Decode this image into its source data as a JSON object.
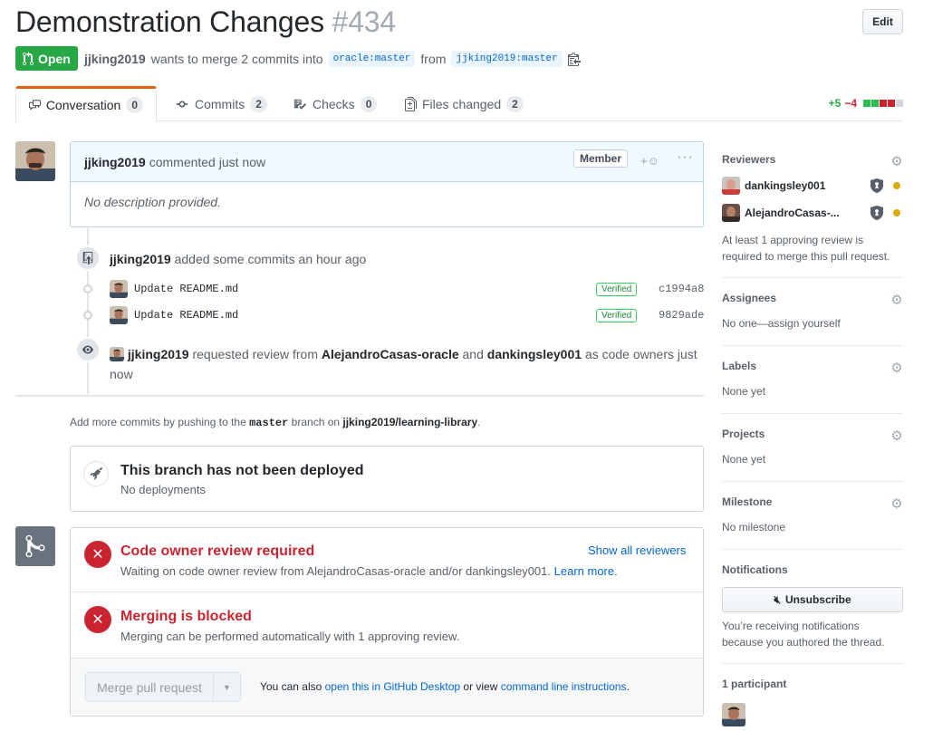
{
  "pr": {
    "title": "Demonstration Changes",
    "number": "#434",
    "edit_label": "Edit",
    "state": "Open",
    "author": "jjking2019",
    "merge_text": "wants to merge 2 commits into",
    "base_branch": "oracle:master",
    "from_text": "from",
    "head_branch": "jjking2019:master"
  },
  "tabs": [
    {
      "label": "Conversation",
      "count": "0"
    },
    {
      "label": "Commits",
      "count": "2"
    },
    {
      "label": "Checks",
      "count": "0"
    },
    {
      "label": "Files changed",
      "count": "2"
    }
  ],
  "diffstat": {
    "additions": "+5",
    "deletions": "−4"
  },
  "comment": {
    "author": "jjking2019",
    "action": "commented just now",
    "role": "Member",
    "body": "No description provided."
  },
  "timeline": {
    "commits_event": {
      "actor": "jjking2019",
      "text": "added some commits an hour ago"
    },
    "commits": [
      {
        "message": "Update README.md",
        "verified": "Verified",
        "sha": "c1994a8"
      },
      {
        "message": "Update README.md",
        "verified": "Verified",
        "sha": "9829ade"
      }
    ],
    "review_event": {
      "actor": "jjking2019",
      "text1": "requested review from",
      "reviewer1": "AlejandroCasas-oracle",
      "and": "and",
      "reviewer2": "dankingsley001",
      "text2": "as code owners",
      "time": "just now"
    }
  },
  "push_note": {
    "prefix": "Add more commits by pushing to the",
    "branch": "master",
    "middle": "branch on",
    "repo": "jjking2019/learning-library",
    "suffix": "."
  },
  "deploy": {
    "title": "This branch has not been deployed",
    "sub": "No deployments"
  },
  "merge_box": {
    "check1_title": "Code owner review required",
    "check1_link": "Show all reviewers",
    "check1_sub": "Waiting on code owner review from AlejandroCasas-oracle and/or dankingsley001.",
    "check1_learn": "Learn more.",
    "check2_title": "Merging is blocked",
    "check2_sub": "Merging can be performed automatically with 1 approving review.",
    "merge_button": "Merge pull request",
    "also_text": "You can also",
    "desktop_link": "open this in GitHub Desktop",
    "or_view": "or view",
    "cli_link": "command line instructions",
    "period": "."
  },
  "sidebar": {
    "reviewers_title": "Reviewers",
    "reviewers": [
      "dankingsley001",
      "AlejandroCasas-..."
    ],
    "reviewers_note": "At least 1 approving review is required to merge this pull request.",
    "assignees_title": "Assignees",
    "assignees_value": "No one—assign yourself",
    "labels_title": "Labels",
    "labels_value": "None yet",
    "projects_title": "Projects",
    "projects_value": "None yet",
    "milestone_title": "Milestone",
    "milestone_value": "No milestone",
    "notifications_title": "Notifications",
    "unsubscribe_label": "Unsubscribe",
    "notifications_note": "You’re receiving notifications because you authored the thread.",
    "participants_title": "1 participant"
  },
  "colors": {
    "open_green": "#28a745",
    "accent_orange": "#e36209",
    "error_red": "#cb2431",
    "link_blue": "#0366d6"
  }
}
